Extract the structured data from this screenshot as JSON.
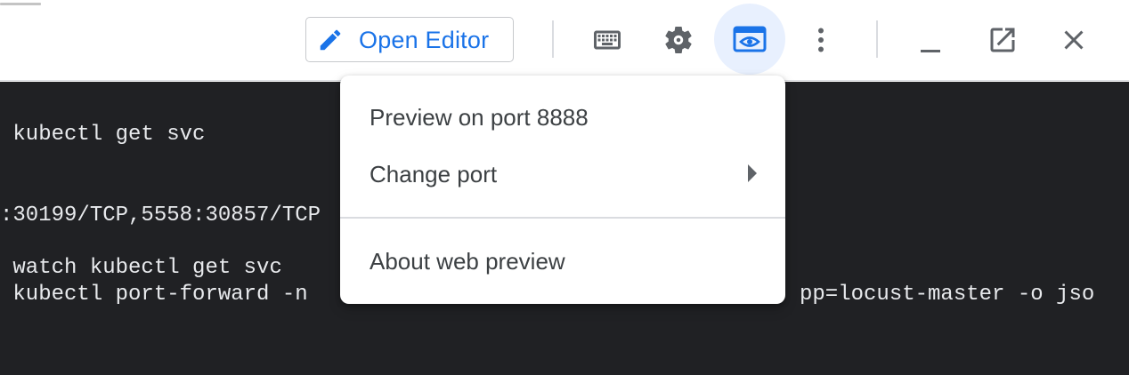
{
  "toolbar": {
    "open_editor_label": "Open Editor",
    "icons": [
      "pencil-icon",
      "keyboard-icon",
      "settings-gear-icon",
      "web-preview-icon",
      "more-vert-icon",
      "minimize-icon",
      "open-in-new-icon",
      "close-icon"
    ],
    "accent_color": "#1a73e8",
    "active_bg_color": "#e8f0fe"
  },
  "terminal": {
    "background": "#202124",
    "lines": [
      " kubectl get svc",
      ":30199/TCP,5558:30857/TCP",
      " watch kubectl get svc",
      " kubectl port-forward -n",
      "pp=locust-master -o jso"
    ]
  },
  "menu": {
    "items": [
      {
        "label": "Preview on port 8888"
      },
      {
        "label": "Change port"
      },
      {
        "label": "About web preview"
      }
    ]
  }
}
